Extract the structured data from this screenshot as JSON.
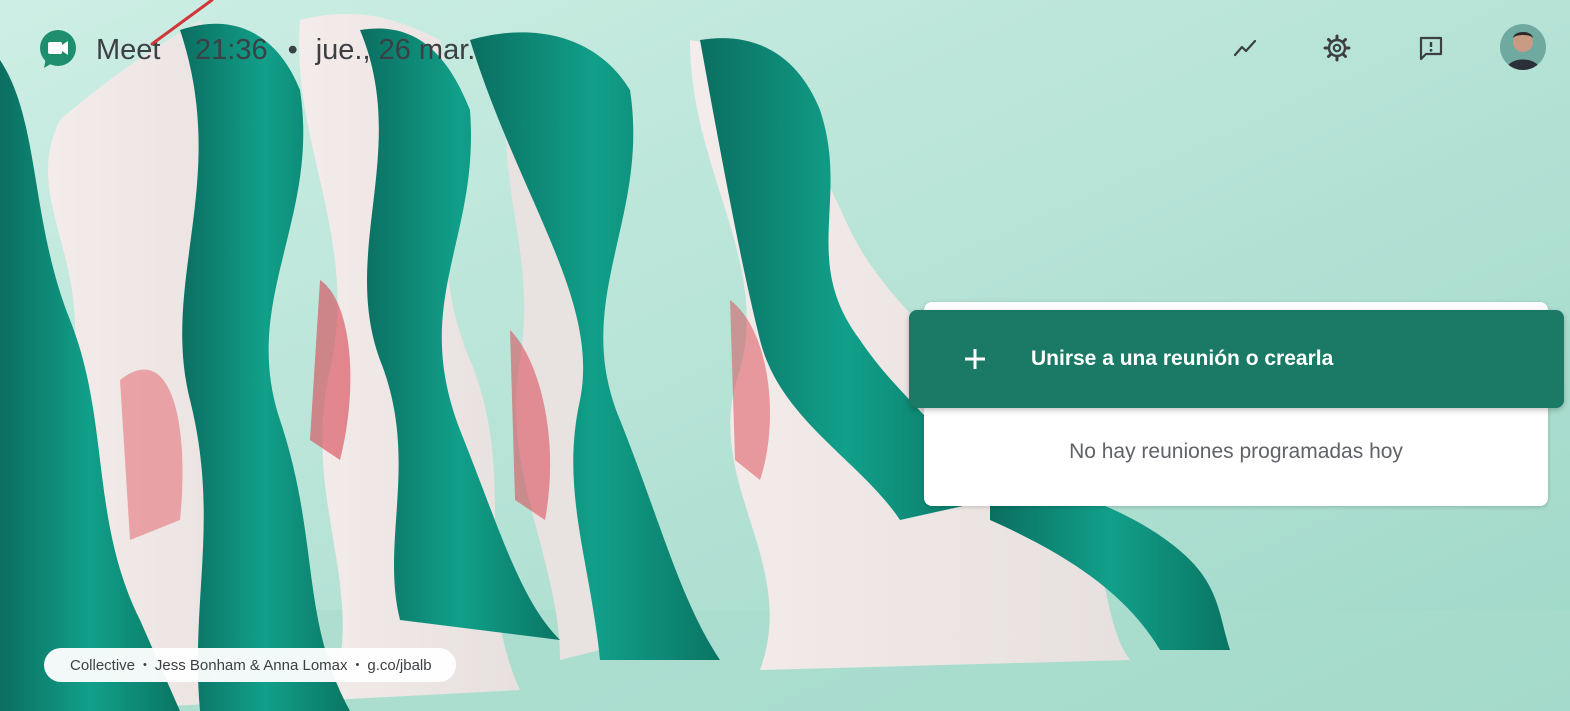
{
  "app": {
    "name": "Meet",
    "time": "21:36",
    "separator": "•",
    "date": "jue., 26 mar."
  },
  "header_icons": [
    "activity-trend-icon",
    "settings-gear-icon",
    "feedback-icon",
    "account-avatar"
  ],
  "main": {
    "join_button_label": "Unirse a una reunión o crearla",
    "empty_state": "No hay reuniones programadas hoy"
  },
  "background_credit": {
    "title": "Collective",
    "authors": "Jess Bonham & Anna Lomax",
    "link": "g.co/jbalb",
    "separator": "•"
  },
  "colors": {
    "accent": "#1a7a65",
    "wave_green": "#0f8f7c",
    "background": "#bfe6da",
    "annotation": "#d0373a"
  }
}
